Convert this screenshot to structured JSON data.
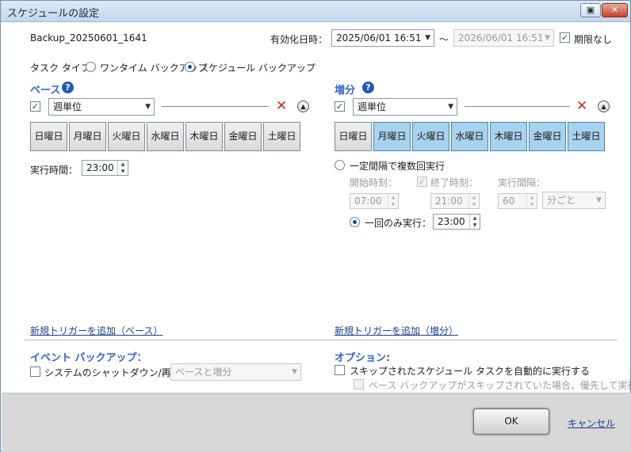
{
  "window": {
    "title": "スケジュールの設定"
  },
  "header": {
    "backup_name": "Backup_20250601_1641",
    "effective_label": "有効化日時：",
    "start_datetime": "2025/06/01 16:51",
    "tilde": "～",
    "end_datetime": "2026/06/01 16:51",
    "no_expiry_label": "期限なし",
    "no_expiry_checked": true
  },
  "task_type": {
    "label": "タスク タイプ：",
    "options": [
      "ワンタイム バックアップ",
      "スケジュール バックアップ"
    ],
    "selected": "スケジュール バックアップ"
  },
  "base": {
    "heading": "ベース",
    "enabled": true,
    "frequency": "週単位",
    "days": [
      "日曜日",
      "月曜日",
      "火曜日",
      "水曜日",
      "木曜日",
      "金曜日",
      "土曜日"
    ],
    "selected_days": [
      "日曜日"
    ],
    "run_time_label": "実行時間：",
    "run_time": "23:00",
    "add_trigger_link": "新規トリガーを追加（ベース）"
  },
  "incremental": {
    "heading": "増分",
    "enabled": true,
    "frequency": "週単位",
    "days": [
      "日曜日",
      "月曜日",
      "火曜日",
      "水曜日",
      "木曜日",
      "金曜日",
      "土曜日"
    ],
    "selected_days": [
      "月曜日",
      "火曜日",
      "水曜日",
      "木曜日",
      "金曜日",
      "土曜日"
    ],
    "interval_run_label": "一定間隔で複数回実行",
    "start_time_label": "開始時刻：",
    "start_time": "07:00",
    "end_time_label": "終了時刻：",
    "end_time": "21:00",
    "interval_label": "実行間隔：",
    "interval_value": "60",
    "interval_unit": "分ごと",
    "once_label": "一回のみ実行：",
    "once_time": "23:00",
    "add_trigger_link": "新規トリガーを追加（増分）"
  },
  "event_backup": {
    "heading": "イベント バックアップ：",
    "shutdown_label": "システムのシャットダウン/再起動",
    "shutdown_option": "ベースと増分"
  },
  "options": {
    "heading": "オプション:",
    "auto_run_label": "スキップされたスケジュール タスクを自動的に実行する",
    "priority_label": "ベース バックアップがスキップされていた場合、優先して実行する"
  },
  "footer": {
    "ok_label": "OK",
    "cancel_label": "キャンセル"
  }
}
